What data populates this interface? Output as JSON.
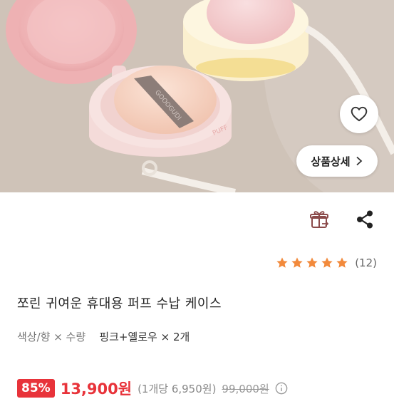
{
  "hero": {
    "image_name": "puff-case-photo",
    "brand_print": "GOOOGUDI",
    "detail_button_label": "상품상세"
  },
  "rating": {
    "stars": 5,
    "count_label": "(12)"
  },
  "product": {
    "title": "쪼린 귀여운 휴대용 퍼프 수납 케이스",
    "option_label": "색상/향 × 수량",
    "option_value": "핑크+옐로우 × 2개"
  },
  "price": {
    "discount": "85%",
    "sale_price": "13,900원",
    "unit_price": "(1개당 6,950원)",
    "original_price": "99,000원"
  },
  "colors": {
    "accent": "#e8333a",
    "star": "#f28a3c",
    "gift_icon": "#8b4a4a"
  }
}
